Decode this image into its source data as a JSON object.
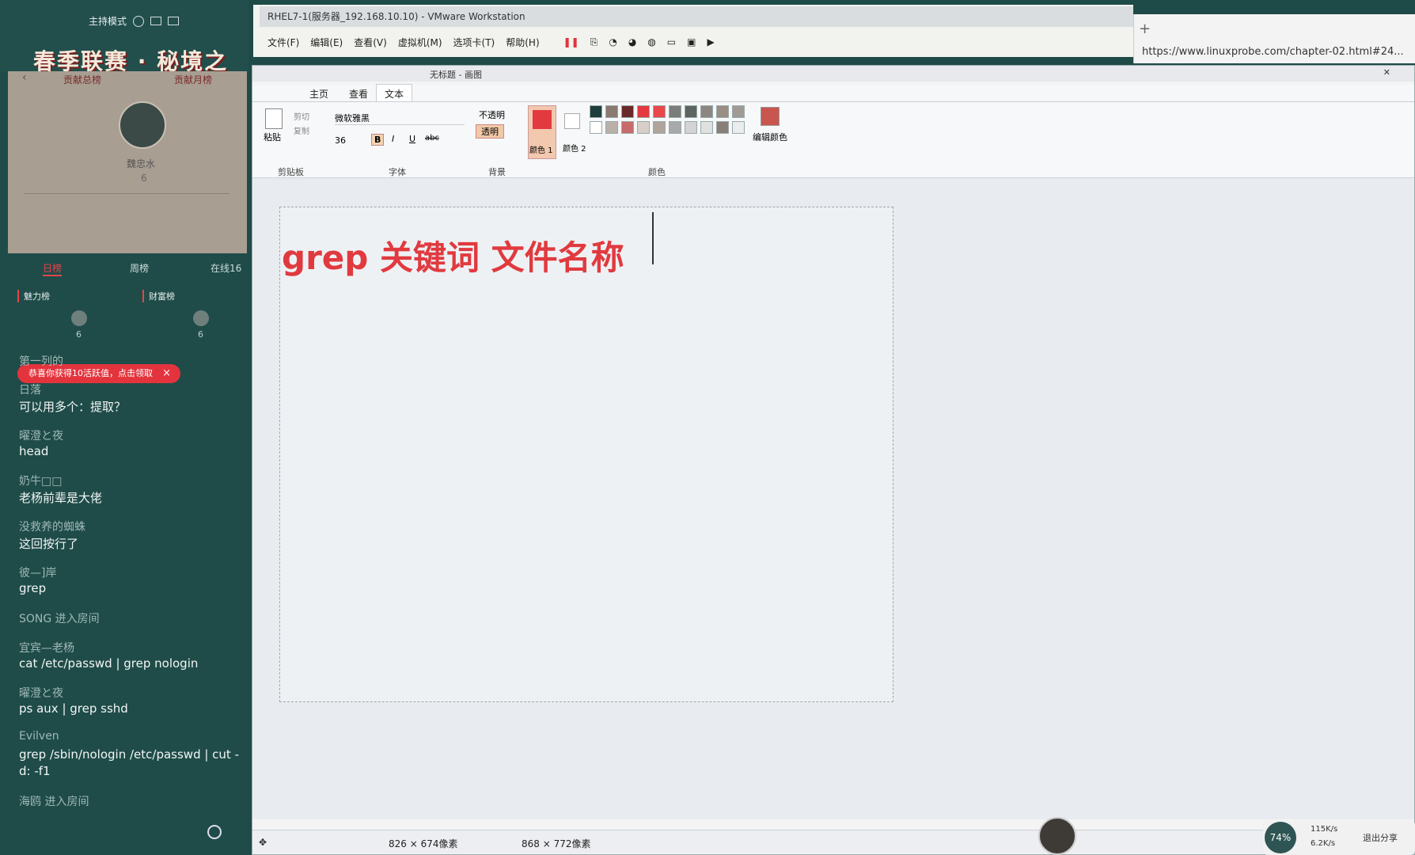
{
  "left_panel": {
    "mode_label": "主持模式",
    "banner": "春季联赛 · 秘境之旅",
    "tab_left": "贡献总榜",
    "tab_right": "贡献月榜",
    "user_name": "魏忠水",
    "user_count": "6",
    "rank_tabs": [
      "日榜",
      "周榜",
      "在线16"
    ],
    "charm": "魅力榜",
    "wealth": "财富榜",
    "charm_count": "6",
    "wealth_count": "6",
    "toast": "恭喜你获得10活跃值，点击领取",
    "toast_close": "×",
    "messages": [
      {
        "name": "第一列的",
        "text": ""
      },
      {
        "name": "日落",
        "text": "可以用多个：提取？"
      },
      {
        "name": "曜澄と夜",
        "text": "head"
      },
      {
        "name": "奶牛□□",
        "text": "老杨前辈是大佬"
      },
      {
        "name": "没救养的蜘蛛",
        "text": "这回按行了"
      },
      {
        "name": "彼—]岸",
        "text": "grep"
      },
      {
        "name": "SONG 进入房间",
        "text": ""
      },
      {
        "name": "宜宾—老杨",
        "text": "cat /etc/passwd | grep nologin"
      },
      {
        "name": "曜澄と夜",
        "text": "ps aux | grep sshd"
      },
      {
        "name": "Evilven",
        "text": "grep /sbin/nologin /etc/passwd | cut -d: -f1"
      },
      {
        "name": "海鸥 进入房间",
        "text": ""
      }
    ]
  },
  "vmware": {
    "title": "RHEL7-1(服务器_192.168.10.10) - VMware Workstation",
    "menu": [
      "文件(F)",
      "编辑(E)",
      "查看(V)",
      "虚拟机(M)",
      "选项卡(T)",
      "帮助(H)"
    ]
  },
  "browser": {
    "url": "https://www.linuxprobe.com/chapter-02.html#24..."
  },
  "paint": {
    "window_title": "无标题 - 画图",
    "tabs": [
      "主页",
      "查看",
      "文本"
    ],
    "clipboard": {
      "paste": "粘贴",
      "cut": "剪切",
      "copy": "复制",
      "group": "剪贴板"
    },
    "font": {
      "name": "微软雅黑",
      "size": "36",
      "group": "字体",
      "b": "B",
      "i": "I",
      "u": "U",
      "s": "abc"
    },
    "background": {
      "opaque": "不透明",
      "transparent": "透明",
      "group": "背景"
    },
    "colors": {
      "color1": "颜色 1",
      "color2": "颜色 2",
      "edit": "编辑颜色",
      "group": "颜色"
    },
    "canvas_text": "grep  关键词  文件名称",
    "status": {
      "size1": "826 × 674像素",
      "size2": "868 × 772像素"
    }
  },
  "palette": [
    "#1d3e3b",
    "#8a7a70",
    "#6b2a2a",
    "#e23a40",
    "#e9474a",
    "#7a7d7a",
    "#5c6560",
    "#8b8780",
    "#9a8e84",
    "#a09a94"
  ],
  "accent": "#e03a3f",
  "net": {
    "pct": "74%",
    "up": "115K/s",
    "down": "6.2K/s",
    "share": "退出分享"
  }
}
